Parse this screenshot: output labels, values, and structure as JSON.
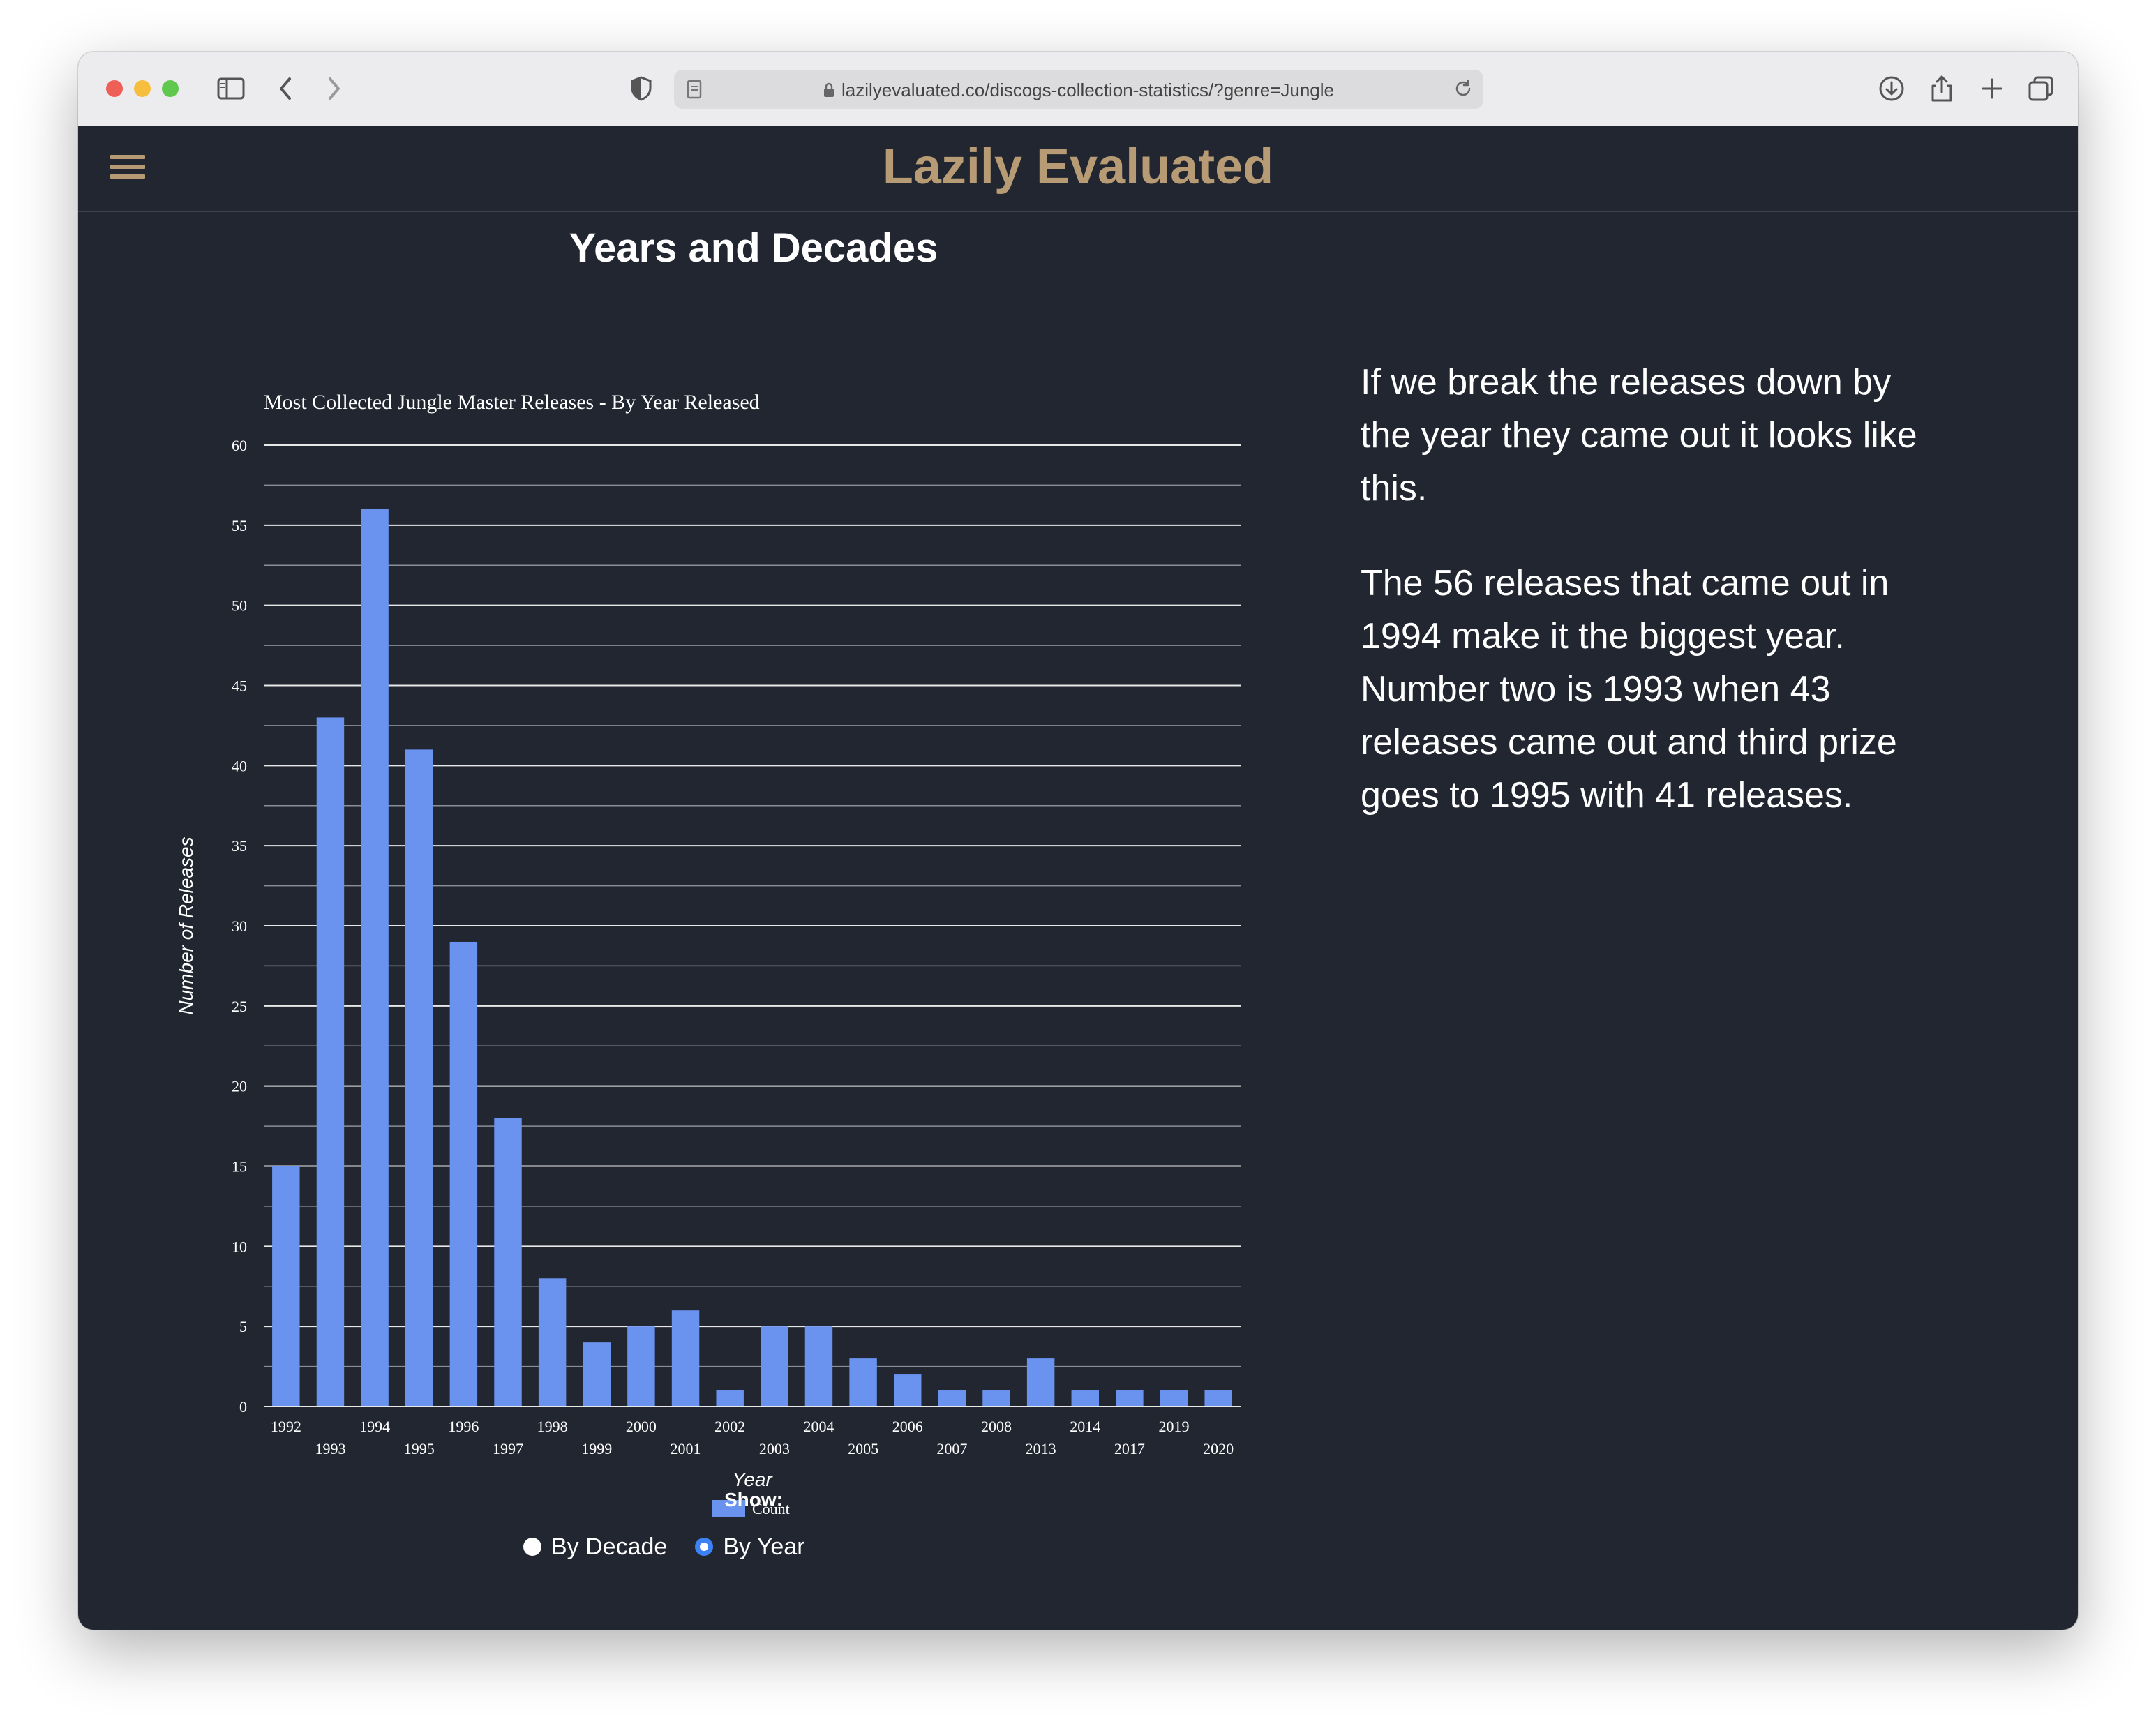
{
  "browser": {
    "url": "lazilyevaluated.co/discogs-collection-statistics/?genre=Jungle"
  },
  "site": {
    "title": "Lazily Evaluated"
  },
  "section": {
    "title": "Years and Decades"
  },
  "chart_data": {
    "type": "bar",
    "title": "Most Collected Jungle Master Releases - By Year Released",
    "xlabel": "Year",
    "ylabel": "Number of Releases",
    "ylim": [
      0,
      60
    ],
    "yticks": [
      0,
      5,
      10,
      15,
      20,
      25,
      30,
      35,
      40,
      45,
      50,
      55,
      60
    ],
    "grid": true,
    "legend": "bottom",
    "categories": [
      "1992",
      "1993",
      "1994",
      "1995",
      "1996",
      "1997",
      "1998",
      "1999",
      "2000",
      "2001",
      "2002",
      "2003",
      "2004",
      "2005",
      "2006",
      "2007",
      "2008",
      "2013",
      "2014",
      "2017",
      "2019",
      "2020"
    ],
    "series": [
      {
        "name": "Count",
        "color": "#6a93f0",
        "values": [
          15,
          43,
          56,
          41,
          29,
          18,
          8,
          4,
          5,
          6,
          1,
          5,
          5,
          3,
          2,
          1,
          1,
          3,
          1,
          1,
          1,
          1
        ]
      }
    ]
  },
  "description": {
    "paragraph1": "If we break the releases down by the year they came out it looks like this.",
    "paragraph2": "The 56 releases that came out in 1994 make it the biggest year. Number two is 1993 when 43 releases came out and third prize goes to 1995 with 41 releases."
  },
  "controls": {
    "show_label": "Show:",
    "options": [
      {
        "label": "By Decade",
        "selected": false
      },
      {
        "label": "By Year",
        "selected": true
      }
    ]
  },
  "colors": {
    "background": "#222630",
    "accent": "#b79b74",
    "bar": "#6a93f0",
    "radio_selected": "#3c82f6"
  }
}
